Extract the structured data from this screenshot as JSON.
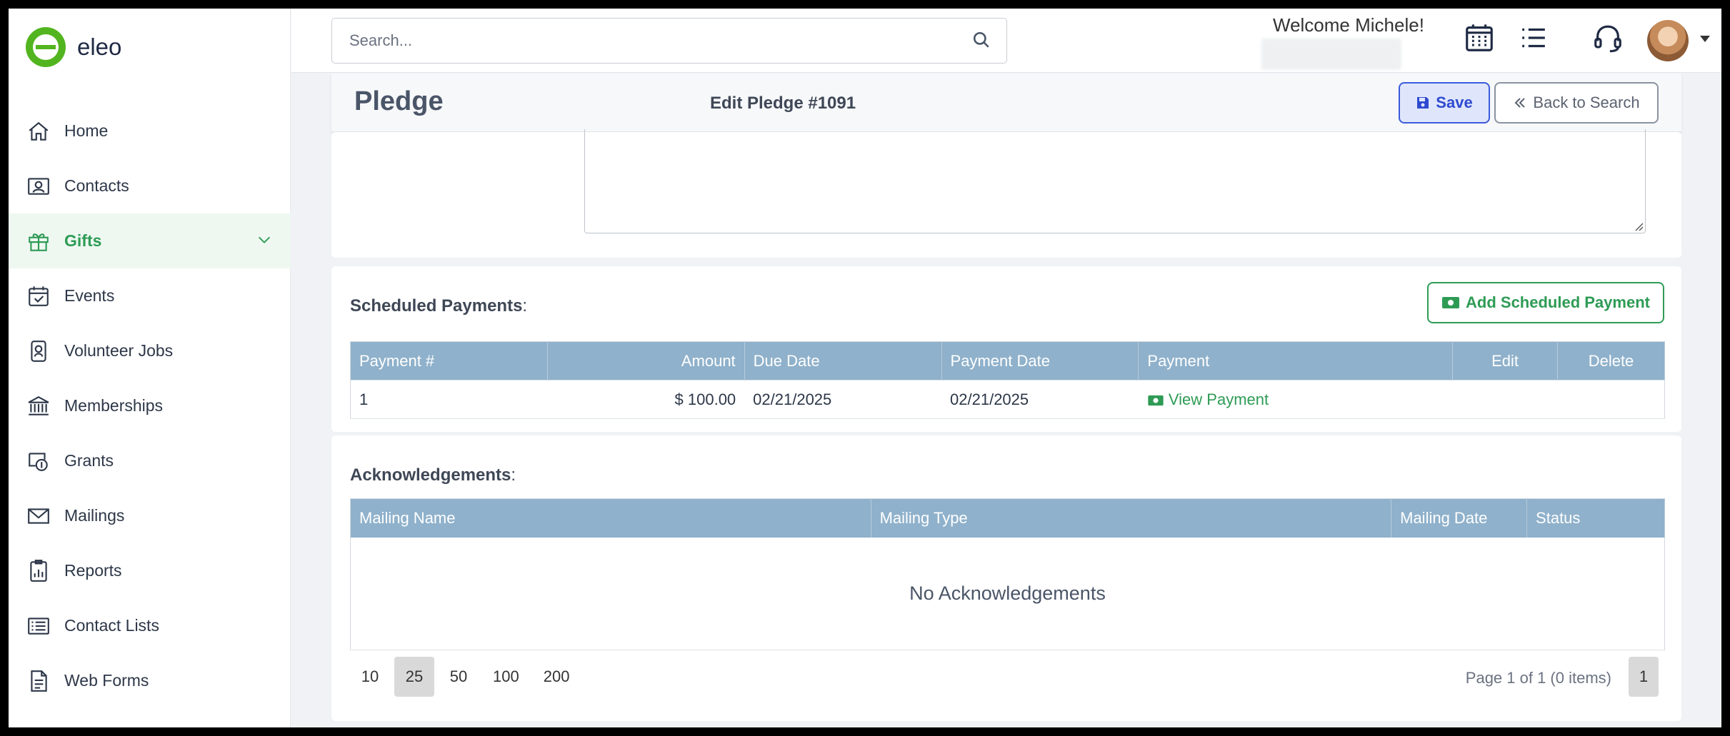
{
  "app": {
    "name": "eleo"
  },
  "sidebar": {
    "items": [
      {
        "label": "Home",
        "icon": "home-icon"
      },
      {
        "label": "Contacts",
        "icon": "contact-card-icon"
      },
      {
        "label": "Gifts",
        "icon": "gift-icon",
        "active": true
      },
      {
        "label": "Events",
        "icon": "calendar-check-icon"
      },
      {
        "label": "Volunteer Jobs",
        "icon": "badge-icon"
      },
      {
        "label": "Memberships",
        "icon": "bank-icon"
      },
      {
        "label": "Grants",
        "icon": "grant-icon"
      },
      {
        "label": "Mailings",
        "icon": "envelope-icon"
      },
      {
        "label": "Reports",
        "icon": "report-icon"
      },
      {
        "label": "Contact Lists",
        "icon": "list-icon"
      },
      {
        "label": "Web Forms",
        "icon": "form-icon"
      }
    ]
  },
  "header": {
    "search_placeholder": "Search...",
    "welcome": "Welcome Michele!"
  },
  "titlebar": {
    "title": "Pledge",
    "edit_title": "Edit Pledge #1091",
    "save_label": "Save",
    "back_label": "Back to Search"
  },
  "scheduled": {
    "title": "Scheduled Payments",
    "add_label": "Add Scheduled Payment",
    "columns": [
      "Payment #",
      "Amount",
      "Due Date",
      "Payment Date",
      "Payment",
      "Edit",
      "Delete"
    ],
    "rows": [
      {
        "payment_no": "1",
        "amount": "$ 100.00",
        "due_date": "02/21/2025",
        "payment_date": "02/21/2025",
        "payment": "View Payment"
      }
    ]
  },
  "acknowledgements": {
    "title": "Acknowledgements",
    "columns": [
      "Mailing Name",
      "Mailing Type",
      "Mailing Date",
      "Status"
    ],
    "empty": "No Acknowledgements",
    "page_sizes": [
      "10",
      "25",
      "50",
      "100",
      "200"
    ],
    "selected_page_size": "25",
    "page_info": "Page 1 of 1 (0 items)",
    "current_page": "1"
  },
  "colors": {
    "accent": "#2e9b55",
    "header_row": "#8fb1cb",
    "save": "#3b5bdb"
  }
}
